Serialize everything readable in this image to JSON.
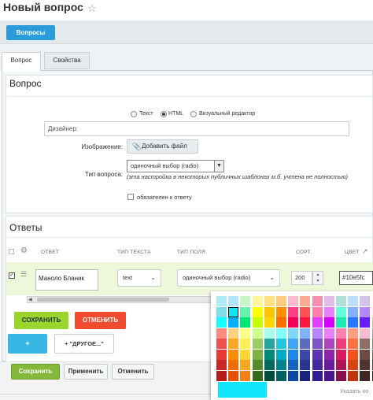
{
  "page": {
    "title": "Новый вопрос"
  },
  "nav": {
    "back_button": "Вопросы"
  },
  "tabs": [
    {
      "label": "Вопрос"
    },
    {
      "label": "Свойства"
    }
  ],
  "question": {
    "section_title": "Вопрос",
    "format_options": [
      {
        "label": "Текст"
      },
      {
        "label": "HTML"
      },
      {
        "label": "Визуальный редактор"
      }
    ],
    "format_selected": "HTML",
    "text_value": "Дизайнер:",
    "image_label": "Изображение:",
    "add_file_label": "Добавить файл",
    "type_label": "Тип вопроса:",
    "type_value": "одиночный выбор (radio)",
    "type_note": "(эта настройка в некоторых публичных шаблонах м.б. учтена не полностью)",
    "required_label": "обязателен к ответу"
  },
  "answers": {
    "section_title": "Ответы",
    "columns": [
      "ОТВЕТ",
      "ТИП ТЕКСТА",
      "ТИП ПОЛЯ",
      "СОРТ.",
      "ЦВЕТ"
    ],
    "rows": [
      {
        "answer": "Маноло Бланик",
        "text_type": "text",
        "field_type": "одиночный выбор (radio)",
        "sort": "200",
        "color": "#10e5fc"
      }
    ],
    "save_label": "СОХРАНИТЬ",
    "cancel_label": "ОТМЕНИТЬ",
    "add_label": "+",
    "other_label": "+ \"ДРУГОЕ...\""
  },
  "footer": {
    "save": "Сохранить",
    "apply": "Применить",
    "cancel": "Отменить"
  },
  "palette": {
    "selected": "#10e5fc",
    "show_codes_label": "Указать ко",
    "rows": [
      [
        "#b2ebf2",
        "#b3e5fc",
        "#c8f7c5",
        "#fff59d",
        "#ffe082",
        "#ffcc80",
        "#f8bbd0",
        "#ffab91",
        "#f48fb1",
        "#e1bee7",
        "#b2dfdb",
        "#bbdefb",
        "#d1c4e9",
        "#f5f5f5"
      ],
      [
        "#80deea",
        "#10e5fc",
        "#69f0ae",
        "#ffff00",
        "#ffc400",
        "#ff9100",
        "#ff4081",
        "#ff5252",
        "#ff80ab",
        "#ea80fc",
        "#64ffda",
        "#82b1ff",
        "#b388ff",
        "#eeeeee"
      ],
      [
        "#18ffff",
        "#00b0ff",
        "#00e676",
        "#c6ff00",
        "#ffd600",
        "#ff6d00",
        "#f50057",
        "#ff1744",
        "#e040fb",
        "#d500f9",
        "#1de9b6",
        "#2979ff",
        "#651fff",
        "#bdbdbd"
      ],
      [
        "#ff8a80",
        "#ffd180",
        "#ffff8d",
        "#ccff90",
        "#a7ffeb",
        "#84ffff",
        "#80d8ff",
        "#82b1ff",
        "#b388ff",
        "#ea80fc",
        "#ff80ab",
        "#ff9e80",
        "#f8bbd0",
        "#9e9e9e"
      ],
      [
        "#ef5350",
        "#ffa726",
        "#ffee58",
        "#9ccc65",
        "#26a69a",
        "#26c6da",
        "#42a5f5",
        "#5c6bc0",
        "#7e57c2",
        "#ab47bc",
        "#ec407a",
        "#ff7043",
        "#8d6e63",
        "#757575"
      ],
      [
        "#e53935",
        "#fb8c00",
        "#fdd835",
        "#7cb342",
        "#00897b",
        "#00acc1",
        "#1e88e5",
        "#3949ab",
        "#5e35b1",
        "#8e24aa",
        "#d81b60",
        "#f4511e",
        "#6d4c41",
        "#616161"
      ],
      [
        "#c62828",
        "#ef6c00",
        "#f9a825",
        "#558b2f",
        "#00695c",
        "#00838f",
        "#1565c0",
        "#283593",
        "#4527a0",
        "#6a1b9a",
        "#ad1457",
        "#d84315",
        "#4e342e",
        "#424242"
      ],
      [
        "#b71c1c",
        "#e65100",
        "#f57f17",
        "#33691e",
        "#004d40",
        "#006064",
        "#0d47a1",
        "#1a237e",
        "#311b92",
        "#4a148c",
        "#880e4f",
        "#bf360c",
        "#3e2723",
        "#212121"
      ]
    ]
  }
}
